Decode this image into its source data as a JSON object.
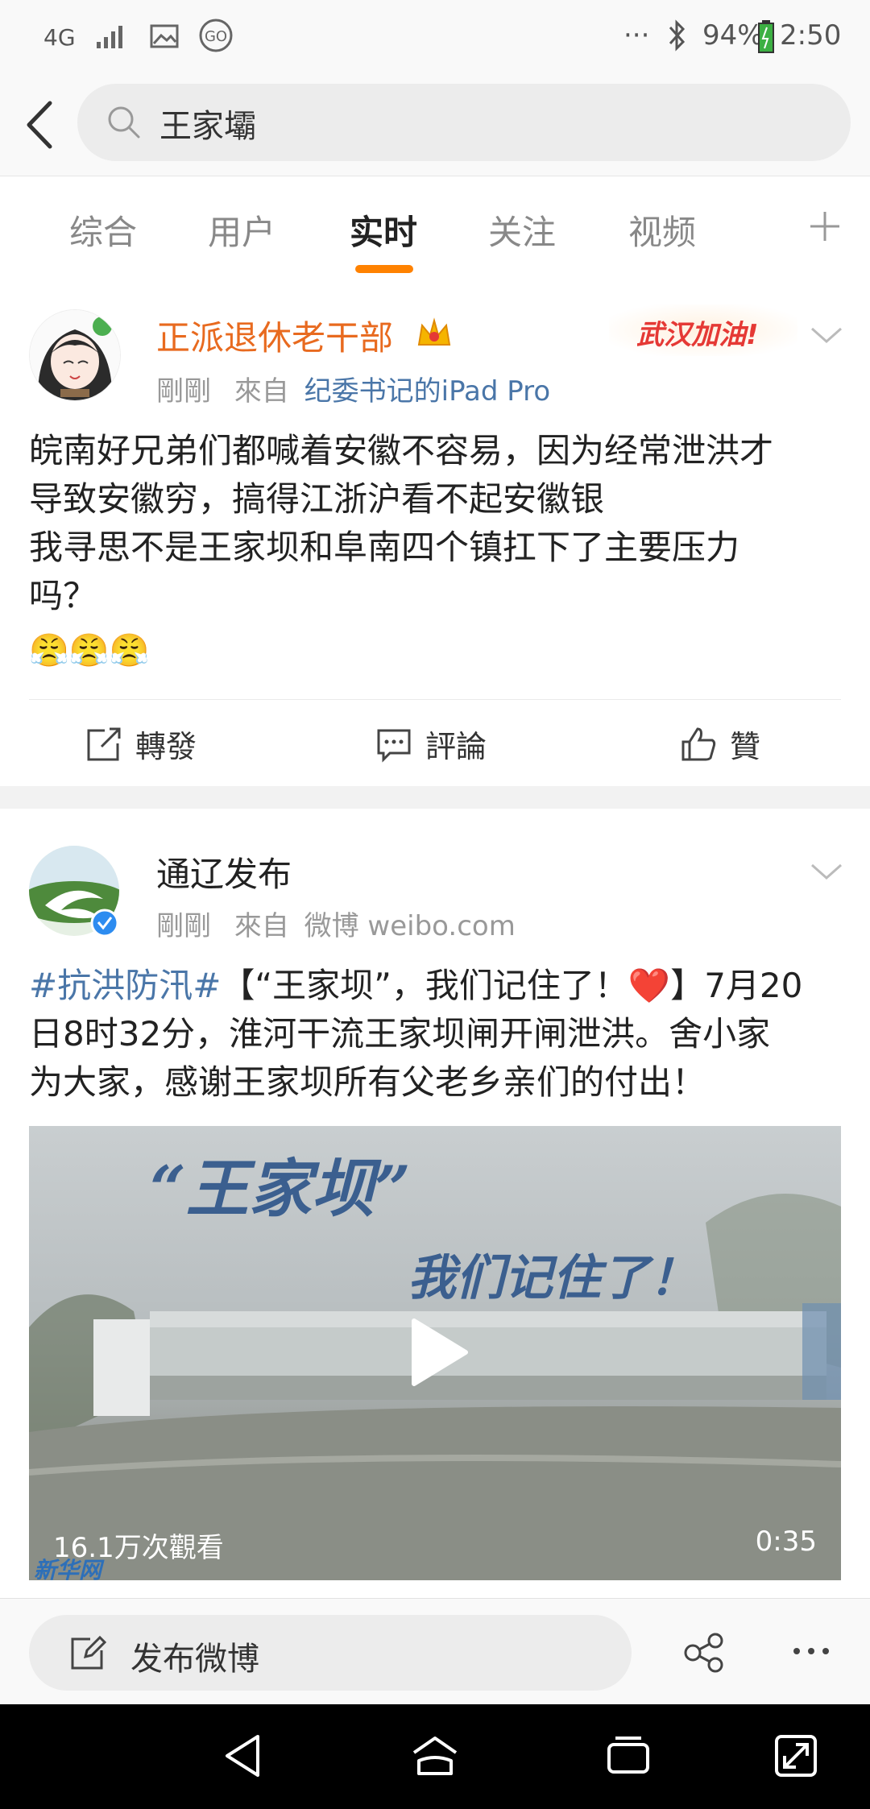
{
  "status_bar": {
    "network": "4G",
    "battery": "94%",
    "time": "2:50",
    "dots": "···"
  },
  "search": {
    "query": "王家壩"
  },
  "tabs": [
    "综合",
    "用户",
    "实时",
    "关注",
    "视频"
  ],
  "active_tab": "实时",
  "posts": [
    {
      "author": "正派退休老干部",
      "author_color": "#e86a1f",
      "time": "剛剛",
      "from_prefix": "來自",
      "source": "纪委书记的iPad Pro",
      "badge": "武汉加油!",
      "lines": [
        "皖南好兄弟们都喊着安徽不容易，因为经常泄洪才",
        "导致安徽穷，搞得江浙沪看不起安徽银",
        "我寻思不是王家坝和阜南四个镇扛下了主要压力",
        "吗？"
      ],
      "emoji": "😤😤😤",
      "actions": {
        "repost": "轉發",
        "comment": "評論",
        "like": "贊"
      }
    },
    {
      "author": "通辽发布",
      "time": "剛剛",
      "from_prefix": "來自",
      "source": "微博 weibo.com",
      "hashtag": "#抗洪防汛#",
      "lines": [
        "【“王家坝”，我们记住了！❤️】7月20",
        "日8时32分，淮河干流王家坝闸开闸泄洪。舍小家",
        "为大家，感谢王家坝所有父老乡亲们的付出！"
      ],
      "video": {
        "title_line1": "“王家坝”",
        "title_line2": "我们记住了！",
        "views": "16.1万次觀看",
        "duration": "0:35",
        "watermark": "新华网"
      }
    }
  ],
  "compose": {
    "label": "发布微博"
  },
  "colors": {
    "accent": "#ff8200",
    "link": "#4a76a8",
    "verified": "#2d8cf0"
  }
}
